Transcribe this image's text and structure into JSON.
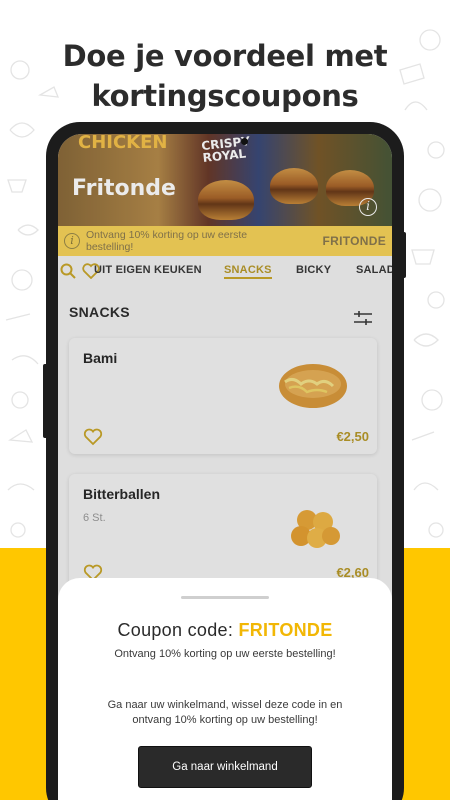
{
  "headline": {
    "line1": "Doe je voordeel met",
    "line2": "kortingscoupons"
  },
  "store": {
    "name": "Fritonde",
    "banner_text_left": "CHICKEN",
    "banner_text_mid": "CRISPY ROYAL"
  },
  "promo": {
    "text": "Ontvang 10% korting op uw eerste bestelling!",
    "code": "FRITONDE"
  },
  "categories": [
    {
      "label": "UIT EIGEN KEUKEN",
      "active": false
    },
    {
      "label": "SNACKS",
      "active": true
    },
    {
      "label": "BICKY",
      "active": false
    },
    {
      "label": "SALADES",
      "active": false
    }
  ],
  "section": {
    "title": "SNACKS"
  },
  "products": [
    {
      "name": "Bami",
      "subtitle": "",
      "price": "€2,50"
    },
    {
      "name": "Bitterballen",
      "subtitle": "6 St.",
      "price": "€2,60"
    }
  ],
  "sheet": {
    "coupon_label": "Coupon code:",
    "coupon_code": "FRITONDE",
    "line1": "Ontvang 10% korting op uw eerste bestelling!",
    "line2": "Ga naar uw winkelmand, wissel deze code in en ontvang 10% korting op uw bestelling!",
    "button_label": "Ga naar winkelmand"
  },
  "colors": {
    "accent_yellow": "#ffc700",
    "coupon_code": "#f2b705",
    "price": "#b89a2a",
    "button_bg": "#2a2a2a"
  },
  "icons": [
    "search-icon",
    "heart-icon",
    "filter-icon",
    "info-icon"
  ]
}
